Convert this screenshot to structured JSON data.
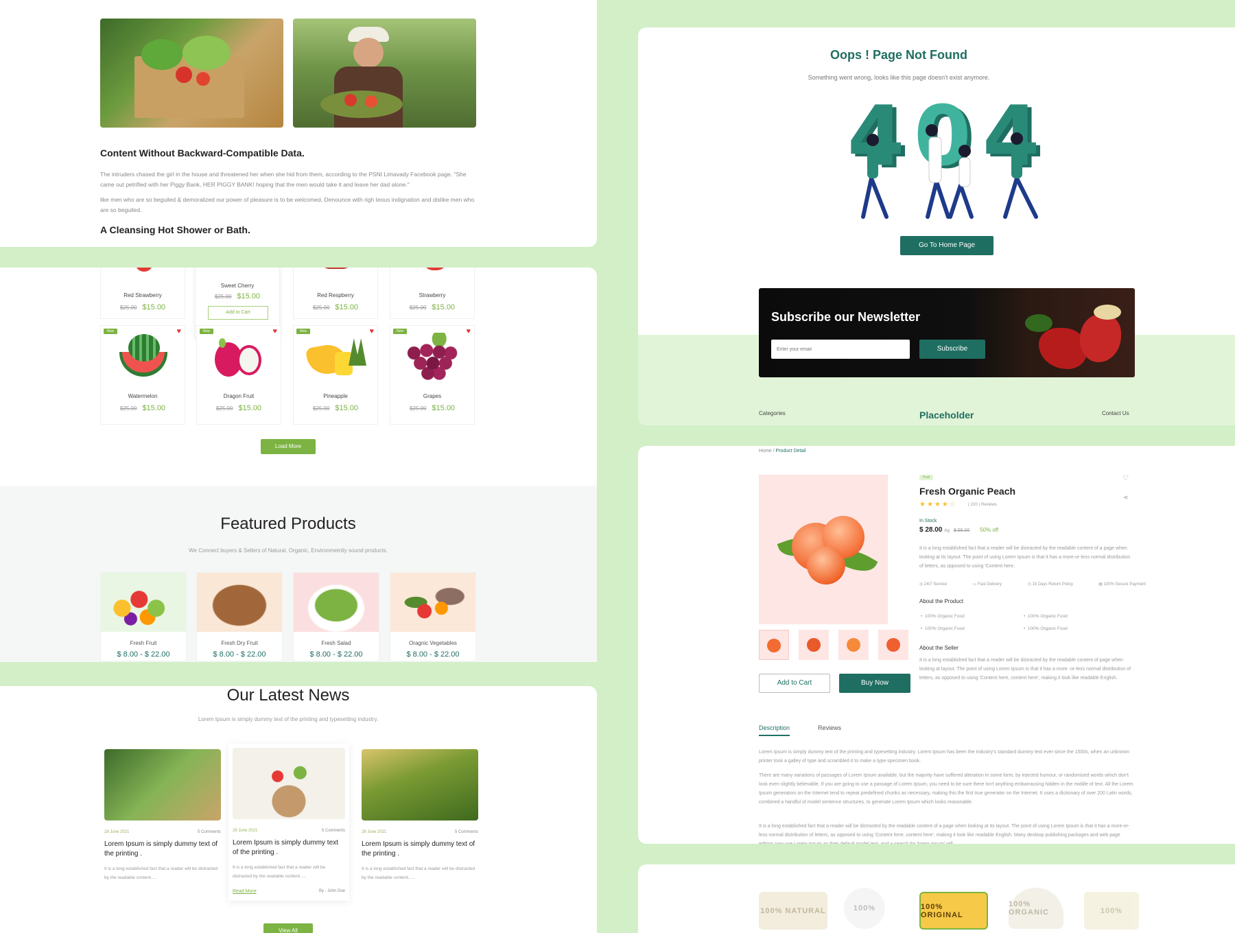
{
  "blog": {
    "heading": "Content Without Backward-Compatible Data.",
    "para1": "The intruders chased the girl in the house and threatened her when she hid from them, according to the PSNI Limavady Facebook page. \"She came out petrified with her Piggy Bank, HER PIGGY BANK! hoping that the men would take it and leave her dad alone.\"",
    "para2": "like men who are so beguiled & demoralized our power of pleasure is to be welcomed. Denounce with righ teous indignation and dislike men who are so beguiled.",
    "subheading": "A Cleansing Hot Shower or Bath."
  },
  "shop": {
    "top_row": [
      {
        "name": "Red Strawberry",
        "old": "$25.00",
        "price": "$15.00"
      },
      {
        "name": "Sweet Cherry",
        "old": "$25.00",
        "price": "$15.00",
        "cta": "Add to Cart"
      },
      {
        "name": "Red Respberry",
        "old": "$25.00",
        "price": "$15.00"
      },
      {
        "name": "Strawberry",
        "old": "$25.00",
        "price": "$15.00"
      }
    ],
    "products": [
      {
        "name": "Watermelon",
        "old": "$25.00",
        "price": "$15.00",
        "badge": "New"
      },
      {
        "name": "Dragon Fruit",
        "old": "$25.00",
        "price": "$15.00",
        "badge": "New"
      },
      {
        "name": "Pineapple",
        "old": "$25.00",
        "price": "$15.00",
        "badge": "New"
      },
      {
        "name": "Grapes",
        "old": "$25.00",
        "price": "$15.00",
        "badge": "New"
      }
    ],
    "load_more": "Load More"
  },
  "featured": {
    "title": "Featured Products",
    "subtitle": "We Connect buyers & Sellers of Natural, Organic, Environmetnlly sound products.",
    "items": [
      {
        "name": "Fresh Fruit",
        "price": "$ 8.00 - $ 22.00"
      },
      {
        "name": "Fresh Dry Fruit",
        "price": "$ 8.00 - $ 22.00"
      },
      {
        "name": "Fresh Salad",
        "price": "$ 8.00 - $ 22.00"
      },
      {
        "name": "Oragnic Vegetables",
        "price": "$ 8.00 - $ 22.00"
      }
    ]
  },
  "news": {
    "title": "Our Latest News",
    "subtitle": "Lorem Ipsum is simply dummy text of the printing and typesetting industry.",
    "items": [
      {
        "date": "28 June 2021",
        "comments": "5 Comments",
        "title": "Lorem Ipsum is simply dummy text of the printing .",
        "desc": "It is a long established fact that a reader will be distracted by the readable content....."
      },
      {
        "date": "28 June 2021",
        "comments": "5 Comments",
        "title": "Lorem Ipsum is simply dummy text of the printing .",
        "desc": "It is a long established fact that a reader will be distracted by the readable content.....",
        "read_more": "Read More",
        "by": "By - John Doe"
      },
      {
        "date": "28 June 2021",
        "comments": "5 Comments",
        "title": "Lorem Ipsum is simply dummy text of the printing .",
        "desc": "It is a long established fact that a reader will be distracted by the readable content....."
      }
    ],
    "view_all": "View All"
  },
  "notfound": {
    "title": "Oops ! Page Not Found",
    "subtitle": "Something went wrong, looks like this page doesn't exist anymore.",
    "digits": [
      "4",
      "0",
      "4"
    ],
    "button": "Go To Home Page"
  },
  "newsletter": {
    "title": "Subscribe our Newsletter",
    "placeholder": "Enter your email",
    "button": "Subscribe"
  },
  "footer": {
    "left": "Categories",
    "center": "Placeholder",
    "right": "Contact Us"
  },
  "product": {
    "breadcrumb_home": "Home",
    "breadcrumb_sep": "/",
    "breadcrumb_current": "Product Detail",
    "tag": "Fruit",
    "name": "Fresh Organic Peach",
    "rating": 4.5,
    "reviews": "( 220 ) Reviews",
    "stock": "In Stock",
    "price": "$ 28.00",
    "unit": "/kg",
    "old_price": "$ 56.00",
    "discount": "50% off",
    "description": "It is a long established fact that a reader will be distracted by the readable content of a page when looking at its layout. The point of using Lorem Ipsum is that it has a more-or-less normal distribution of letters, as opposed to using 'Content here.",
    "features": [
      "24/7 Service",
      "Fast Delivery",
      "15 Days Return Policy",
      "100% Secure Payment"
    ],
    "about_title": "About the Product",
    "about_items": [
      "100% Organic Food",
      "100% Organic Food",
      "100% Organic Food",
      "100% Organic Food"
    ],
    "seller_title": "About the Seller",
    "seller_text": "It is a long established fact that a reader will be distracted by the readable content of page when looking at layout. The point of using Lorem Ipsum is that it has a more -or-less normal distribution of letters, as opposed to using 'Content here, content here', making it look like readable English.",
    "add_to_cart": "Add to Cart",
    "buy_now": "Buy Now",
    "tabs": [
      "Description",
      "Reviews"
    ],
    "desc_p1": "Lorem Ipsum is simply dummy text of the printing and typesetting industry. Lorem Ipsum has been the industry's standard dummy text ever since the 1500s, when an unknown printer took a galley of type and scrambled it to make a type specimen book.",
    "desc_p2": "There are many variations of passages of Lorem Ipsum available, but the majority have suffered alteration in some form, by injected humour, or randomised words which don't look even slightly believable. If you are going to use a passage of Lorem Ipsum, you need to be sure there isn't anything embarrassing hidden in the middle of text. All the Lorem Ipsum generators on the Internet tend to repeat predefined chunks as necessary, making this the first true generator on the Internet. It uses a dictionary of over 200 Latin words, combined a handful of model sentence structures, to generate Lorem Ipsum which looks reasonable.",
    "desc_p3": "It is a long established fact that a reader will be distracted by the readable content of a page when looking at its layout. The point of using Lorem Ipsum is that it has a more-or-less normal distribution of letters, as opposed to using 'Content here, content here', making it look like readable English. Many desktop publishing packages and web page editors now use Lorem Ipsum as their default model text, and a search for 'lorem ipsum' will"
  },
  "brands": [
    "100% NATURAL",
    "100%",
    "100% ORIGINAL",
    "100% ORGANIC",
    "100%"
  ],
  "colors": {
    "accent_green": "#7cb342",
    "brand_teal": "#1f6e62",
    "bg_mint": "#d2efc7"
  }
}
